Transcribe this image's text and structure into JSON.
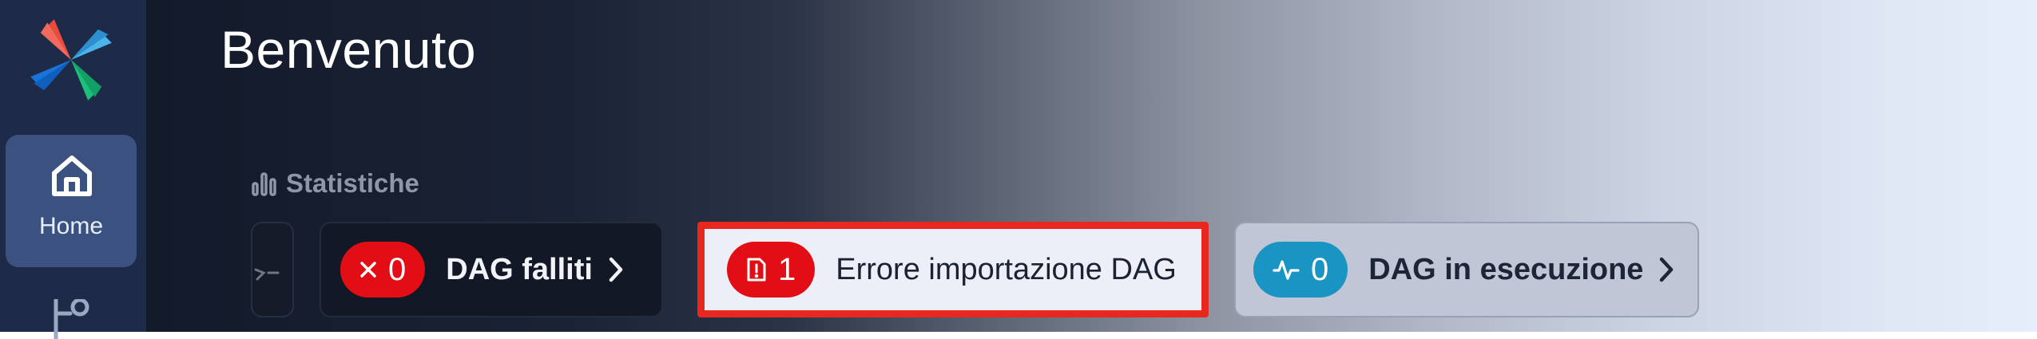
{
  "sidebar": {
    "logo_icon": "pinwheel-logo-icon",
    "items": [
      {
        "label": "Home",
        "icon": "home-icon",
        "active": true
      },
      {
        "label": "",
        "icon": "dag-tree-icon",
        "active": false
      }
    ]
  },
  "main": {
    "title": "Benvenuto",
    "stats": {
      "heading": "Statistiche",
      "heading_icon": "bar-chart-icon",
      "cards": [
        {
          "label": "DAG falliti",
          "count": "0",
          "icon": "x-icon",
          "pill_color": "#e30e15",
          "chevron": "chevron-right-icon"
        },
        {
          "label": "Errore importazione DAG",
          "count": "1",
          "icon": "file-alert-icon",
          "pill_color": "#e30e15",
          "highlighted": true
        },
        {
          "label": "DAG in esecuzione",
          "count": "0",
          "icon": "activity-icon",
          "pill_color": "#1a95c3",
          "chevron": "chevron-right-icon"
        }
      ]
    }
  },
  "colors": {
    "sidebar_bg": "#1d2a48",
    "active_nav_bg": "#3b5280",
    "highlight_border": "#e8281e",
    "error_red": "#e30e15",
    "running_blue": "#1a95c3"
  }
}
